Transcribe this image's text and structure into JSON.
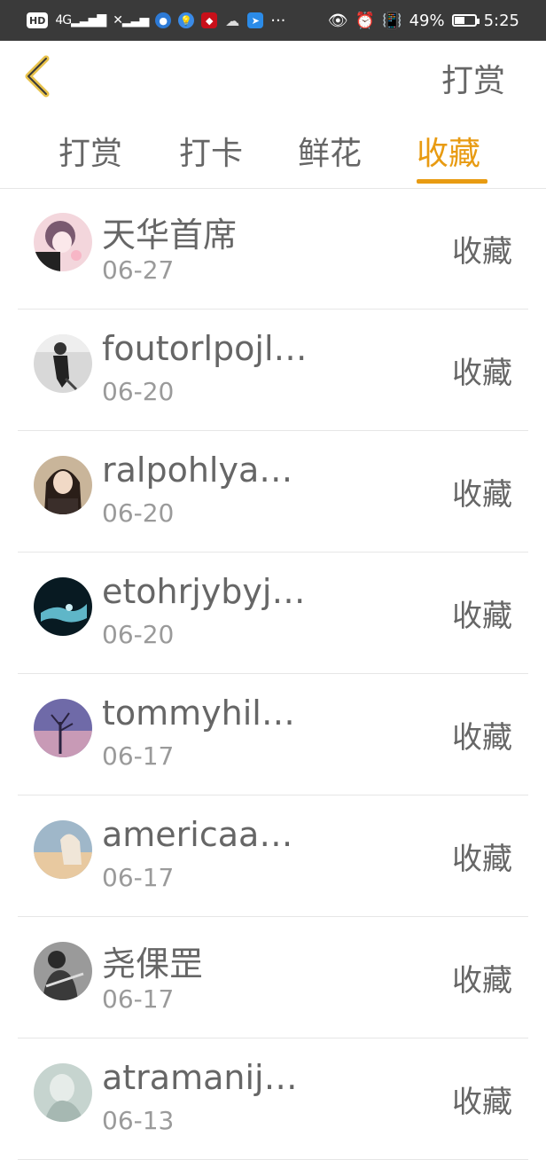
{
  "status_bar": {
    "time": "5:25",
    "battery": "49%",
    "hd_label": "HD",
    "network_label": "4G",
    "more": "···"
  },
  "header": {
    "title": "打赏"
  },
  "tabs": [
    {
      "label": "打赏",
      "active": false
    },
    {
      "label": "打卡",
      "active": false
    },
    {
      "label": "鲜花",
      "active": false
    },
    {
      "label": "收藏",
      "active": true
    }
  ],
  "colors": {
    "accent": "#e89b12",
    "statusbar": "#3a3a3a"
  },
  "items": [
    {
      "name": "天华首席",
      "date": "06-27",
      "action": "收藏",
      "avatar_icon": "avatar-anime-girl"
    },
    {
      "name": "foutorlpojlko",
      "date": "06-20",
      "action": "收藏",
      "avatar_icon": "avatar-grayscale-person"
    },
    {
      "name": "ralpohlyaur...",
      "date": "06-20",
      "action": "收藏",
      "avatar_icon": "avatar-girl"
    },
    {
      "name": "etohrjybyju...",
      "date": "06-20",
      "action": "收藏",
      "avatar_icon": "avatar-dark-blue"
    },
    {
      "name": "tommyhilm...",
      "date": "06-17",
      "action": "收藏",
      "avatar_icon": "avatar-purple-tree"
    },
    {
      "name": "americaant...",
      "date": "06-17",
      "action": "收藏",
      "avatar_icon": "avatar-warm-girl"
    },
    {
      "name": "尧倮罡",
      "date": "06-17",
      "action": "收藏",
      "avatar_icon": "avatar-guitar-person"
    },
    {
      "name": "atramanije...",
      "date": "06-13",
      "action": "收藏",
      "avatar_icon": "avatar-pale-figure"
    }
  ]
}
